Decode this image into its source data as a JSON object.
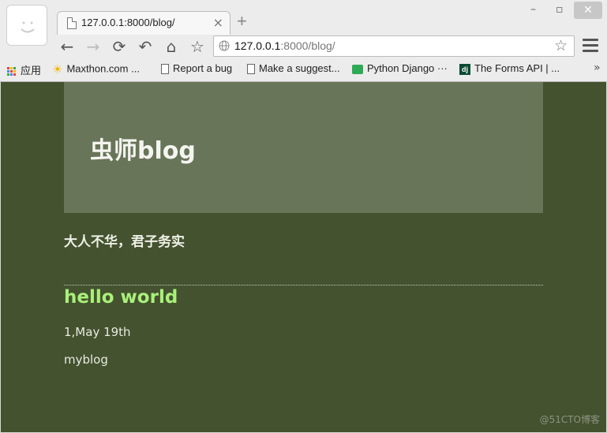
{
  "browser": {
    "tab": {
      "title": "127.0.0.1:8000/blog/",
      "close_glyph": "×"
    },
    "new_tab_glyph": "+",
    "window_controls": {
      "minimize": "–",
      "maximize": "▫",
      "close": "✕"
    },
    "nav": {
      "back": "←",
      "forward": "→",
      "reload": "⟳",
      "undo": "↶",
      "home": "⌂",
      "bookmark": "☆"
    },
    "address": {
      "host": "127.0.0.1",
      "rest": ":8000/blog/",
      "star": "☆"
    },
    "bookmarks": [
      {
        "label": "应用",
        "icon": "apps-grid-icon"
      },
      {
        "label": "Maxthon.com ...",
        "icon": "sun-icon"
      },
      {
        "label": "Report a bug",
        "icon": "page-icon"
      },
      {
        "label": "Make a suggest...",
        "icon": "page-icon"
      },
      {
        "label": "Python Django ···",
        "icon": "green-chat-icon"
      },
      {
        "label": "The Forms API | ...",
        "icon": "django-icon"
      }
    ],
    "bookmarks_overflow": "»"
  },
  "page": {
    "site_title": "虫师blog",
    "tagline": "大人不华，君子务实",
    "post": {
      "title": "hello world",
      "meta": "1,May 19th",
      "body": "myblog"
    },
    "watermark": "@51CTO博客"
  },
  "colors": {
    "page_bg": "#44522f",
    "header_bg": "#687558",
    "post_title": "#a9f07a",
    "text": "#e8eae0"
  }
}
